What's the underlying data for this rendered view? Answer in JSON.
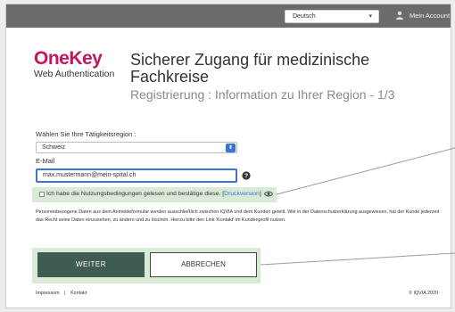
{
  "topbar": {
    "language": "Deutsch",
    "language_arrow": "▾",
    "account_label": "Mein Account"
  },
  "brand": {
    "logo_main": "OneKey",
    "logo_sub": "Web Authentication"
  },
  "header": {
    "title": "Sicherer Zugang für medizinische Fachkreise",
    "subtitle": "Registrierung : Information zu Ihrer Region - 1/3"
  },
  "form": {
    "region_label": "Wählen Sie Ihre Tätigkeitsregion :",
    "region_value": "Schweiz",
    "region_arrow": "⬍",
    "email_label": "E-Mail",
    "email_value": "max.mustermann@mein-spital.ch",
    "terms_text": "Ich habe die Nutzungsbedingungen gelesen und bestätige diese. [",
    "terms_link": "Druckversion",
    "terms_close": "]"
  },
  "privacy_text": "Personenbezogene Daten aus dem Anmeldeformular werden ausschließlich zwischen IQVIA und dem Kunden geteilt. Wie in der Datenschutzerklärung ausgewiesen, hat der Kunde jederzeit das Recht seine Daten einzusehen, zu ändern und zu löschen. Hierzu bitte den Link 'Kontakt' im Kundenprofil nutzen.",
  "buttons": {
    "weiter": "WEITER",
    "abbrechen": "ABBRECHEN"
  },
  "footer": {
    "impressum": "Impressum",
    "separator": "|",
    "kontakt": "Kontakt",
    "copyright": "© IQVIA 2020"
  },
  "colors": {
    "brand": "#c2185b",
    "topbar": "#6b6b6b",
    "accent": "#3b73d9",
    "highlight": "#d9ead6",
    "primary_button": "#3e5c4f"
  },
  "icons": {
    "account": "person-icon",
    "help": "help-icon",
    "print_preview": "eye-icon"
  }
}
